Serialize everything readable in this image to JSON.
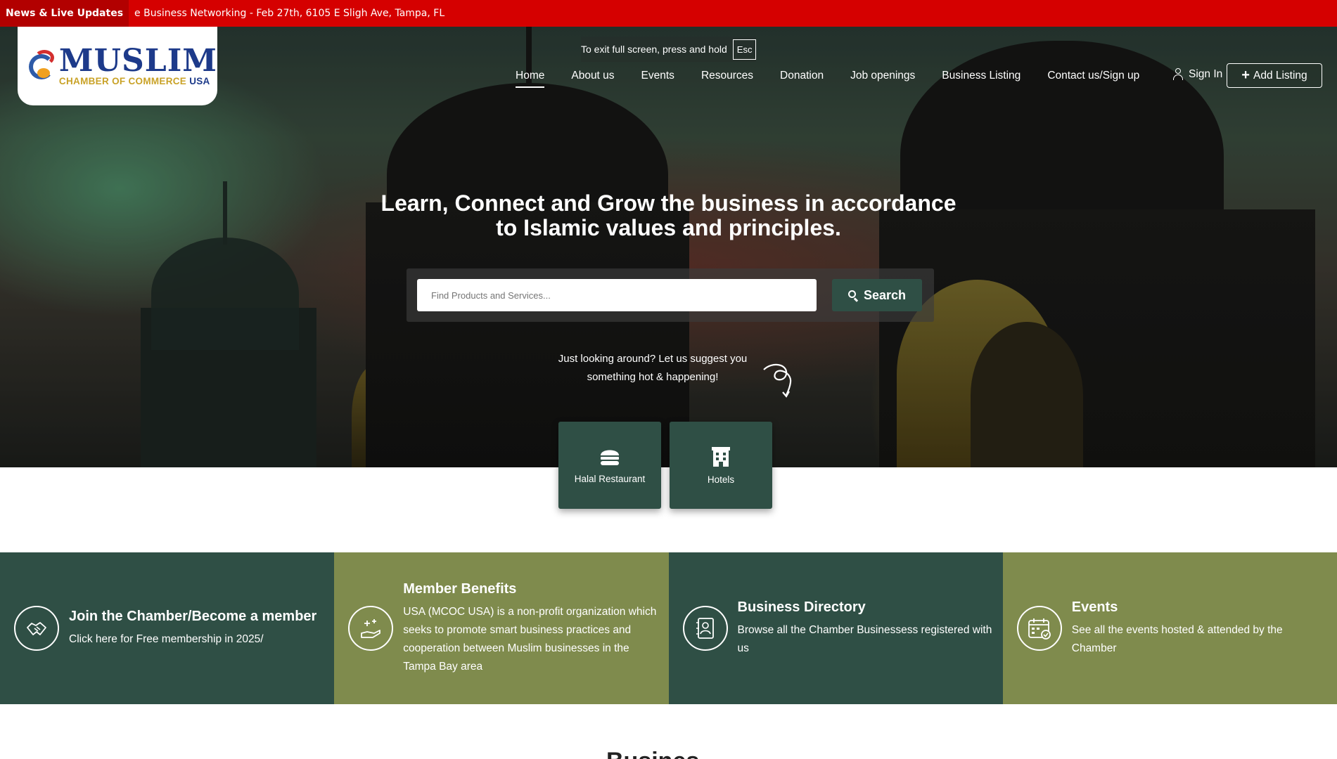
{
  "ticker": {
    "label": "News & Live Updates",
    "text": "e Business Networking - Feb 27th, 6105 E Sligh Ave, Tampa, FL"
  },
  "logo": {
    "main": "MUSLIM",
    "sub": "CHAMBER OF COMMERCE",
    "sub_country": "USA"
  },
  "fullscreen_notice": {
    "text": "To exit full screen, press and hold",
    "key": "Esc"
  },
  "nav": {
    "items": [
      {
        "label": "Home",
        "active": true
      },
      {
        "label": "About us"
      },
      {
        "label": "Events"
      },
      {
        "label": "Resources"
      },
      {
        "label": "Donation"
      },
      {
        "label": "Job openings"
      },
      {
        "label": "Business Listing"
      },
      {
        "label": "Contact us/Sign up"
      }
    ],
    "signin": "Sign In",
    "add_listing": "Add Listing"
  },
  "hero": {
    "title_line1": "Learn, Connect and Grow the business in accordance",
    "title_line2": "to Islamic values and principles.",
    "search_placeholder": "Find Products and Services...",
    "search_button": "Search",
    "suggest_line1": "Just looking around? Let us suggest you",
    "suggest_line2": "something hot & happening!"
  },
  "categories": [
    {
      "label": "Halal Restaurant",
      "icon": "burger-icon"
    },
    {
      "label": "Hotels",
      "icon": "building-icon"
    }
  ],
  "features": [
    {
      "title": "Join the Chamber/Become a member",
      "desc": "Click here for Free membership in 2025/",
      "icon": "handshake-icon",
      "color": "#2f4f45"
    },
    {
      "title": "Member Benefits",
      "desc": "USA (MCOC USA) is a non-profit organization which seeks to promote smart business practices and cooperation between Muslim businesses in the Tampa Bay area",
      "icon": "hand-sparkle-icon",
      "color": "#7f8b4d"
    },
    {
      "title": "Business Directory",
      "desc": "Browse all the Chamber Businessess registered with us",
      "icon": "directory-book-icon",
      "color": "#2f4f45"
    },
    {
      "title": "Events",
      "desc": "See all the events hosted & attended by the Chamber",
      "icon": "calendar-check-icon",
      "color": "#7f8b4d"
    }
  ],
  "section_peek": "Busines",
  "colors": {
    "ticker_red": "#d50000",
    "brand_green": "#2f4f45",
    "olive": "#7f8b4d",
    "logo_blue": "#1d3a8a",
    "logo_gold": "#c9a227"
  }
}
